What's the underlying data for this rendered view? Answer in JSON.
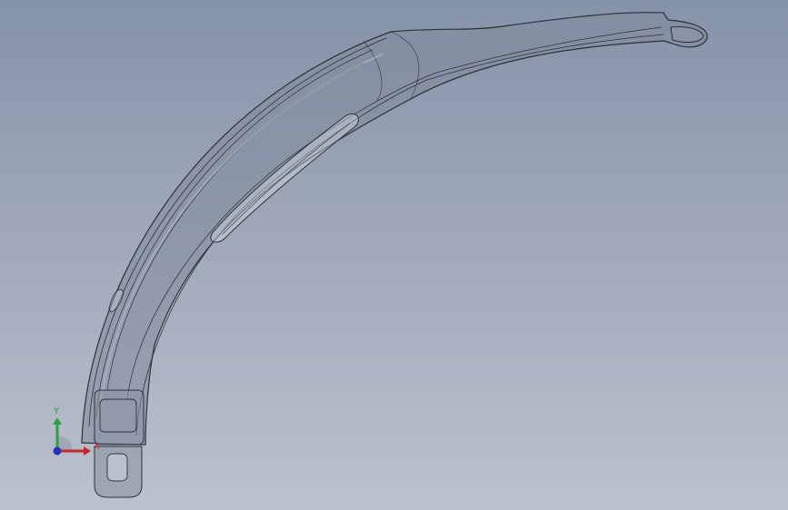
{
  "viewport": {
    "background_top": "#8593a8",
    "background_bottom": "#bcc1ce"
  },
  "model": {
    "shell_fill": "#7f8a9a",
    "edge_color": "#2c3038",
    "highlight_color": "#b3bbc6"
  },
  "triad": {
    "x_label": "X",
    "y_label": "Y",
    "x_color": "#c0282d",
    "y_color": "#2aa13a",
    "z_color": "#2433b8"
  }
}
